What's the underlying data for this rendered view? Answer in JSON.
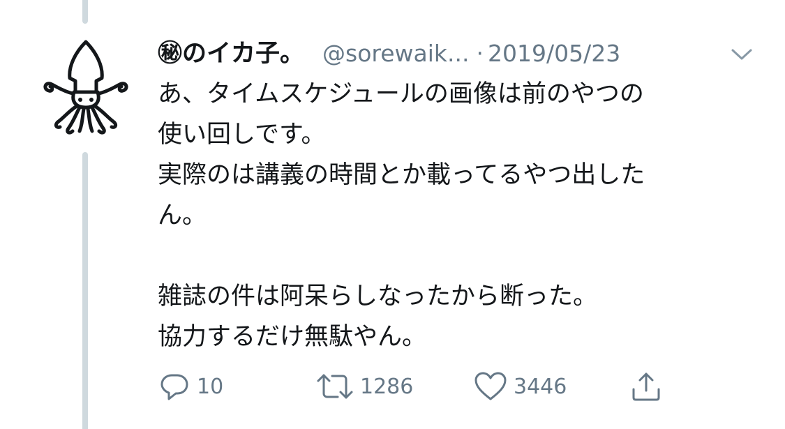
{
  "tweet": {
    "display_name": "㊙のイカ子。",
    "handle": "@sorewaik...",
    "separator": "·",
    "date": "2019/05/23",
    "body": "あ、タイムスケジュールの画像は前のやつの\n使い回しです。\n実際のは講義の時間とか載ってるやつ出した\nん。\n\n雑誌の件は阿呆らしなったから断った。\n協力するだけ無駄やん。"
  },
  "actions": {
    "reply_count": "10",
    "retweet_count": "1286",
    "like_count": "3446"
  },
  "icons": {
    "avatar": "squid-icon",
    "caret": "chevron-down-icon",
    "reply": "reply-icon",
    "retweet": "retweet-icon",
    "like": "heart-icon",
    "share": "share-icon"
  },
  "colors": {
    "text": "#14171a",
    "muted": "#657786",
    "thread_line": "#cfd9de"
  }
}
